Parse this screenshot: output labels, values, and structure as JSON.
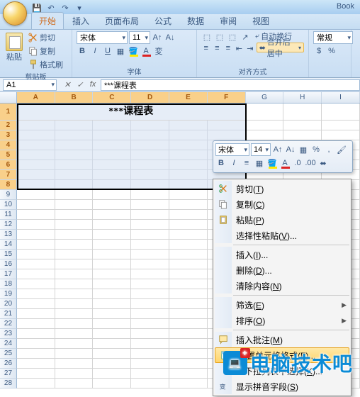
{
  "app": {
    "doc_title": "Book"
  },
  "qat": {
    "save": "save-icon",
    "undo": "undo-icon",
    "redo": "redo-icon"
  },
  "tabs": [
    "开始",
    "插入",
    "页面布局",
    "公式",
    "数据",
    "审阅",
    "视图"
  ],
  "active_tab": 0,
  "ribbon": {
    "clipboard": {
      "paste": "粘贴",
      "cut": "剪切",
      "copy": "复制",
      "format_painter": "格式刷",
      "label": "剪贴板"
    },
    "font": {
      "name": "宋体",
      "size": "11",
      "label": "字体"
    },
    "alignment": {
      "wrap": "自动换行",
      "merge": "合并后居中",
      "label": "对齐方式"
    },
    "number": {
      "format": "常规"
    }
  },
  "namebox": "A1",
  "formula_value": "***课程表",
  "columns": [
    "A",
    "B",
    "C",
    "D",
    "E",
    "F",
    "G",
    "H",
    "I"
  ],
  "selected_cols": [
    "A",
    "B",
    "C",
    "D",
    "E",
    "F"
  ],
  "row_count": 28,
  "selected_rows": [
    1,
    2,
    3,
    4,
    5,
    6,
    7,
    8
  ],
  "merged_cell_text": "***课程表",
  "mini_toolbar": {
    "font": "宋体",
    "size": "14"
  },
  "context_menu": [
    {
      "label": "剪切",
      "key": "T",
      "icon": "cut"
    },
    {
      "label": "复制",
      "key": "C",
      "icon": "copy"
    },
    {
      "label": "粘贴",
      "key": "P",
      "icon": "paste"
    },
    {
      "label": "选择性粘贴",
      "key": "V",
      "trailing": "..."
    },
    {
      "sep": true
    },
    {
      "label": "插入",
      "key": "I",
      "trailing": "..."
    },
    {
      "label": "删除",
      "key": "D",
      "trailing": "..."
    },
    {
      "label": "清除内容",
      "key": "N"
    },
    {
      "sep": true
    },
    {
      "label": "筛选",
      "key": "E",
      "submenu": true
    },
    {
      "label": "排序",
      "key": "O",
      "submenu": true
    },
    {
      "sep": true
    },
    {
      "label": "插入批注",
      "key": "M",
      "icon": "comment"
    },
    {
      "label": "设置单元格格式",
      "key": "F",
      "trailing": "...",
      "icon": "format",
      "highlight": true
    },
    {
      "label": "从下拉列表中选择",
      "key": "K",
      "trailing": "..."
    },
    {
      "label": "显示拼音字段",
      "key": "S",
      "icon": "pinyin"
    }
  ],
  "watermark": {
    "text": "电脑技术吧",
    "icon_text": "📺"
  }
}
